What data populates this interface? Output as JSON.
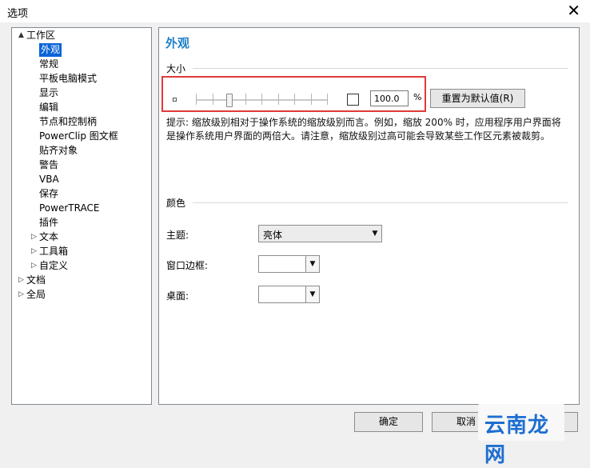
{
  "window": {
    "title": "选项"
  },
  "tree": [
    {
      "label": "工作区",
      "expander": "▲",
      "indent": 0,
      "selected": false
    },
    {
      "label": "外观",
      "expander": "",
      "indent": 1,
      "selected": true
    },
    {
      "label": "常规",
      "expander": "",
      "indent": 1,
      "selected": false
    },
    {
      "label": "平板电脑模式",
      "expander": "",
      "indent": 1,
      "selected": false
    },
    {
      "label": "显示",
      "expander": "",
      "indent": 1,
      "selected": false
    },
    {
      "label": "编辑",
      "expander": "",
      "indent": 1,
      "selected": false
    },
    {
      "label": "节点和控制柄",
      "expander": "",
      "indent": 1,
      "selected": false
    },
    {
      "label": "PowerClip 图文框",
      "expander": "",
      "indent": 1,
      "selected": false
    },
    {
      "label": "贴齐对象",
      "expander": "",
      "indent": 1,
      "selected": false
    },
    {
      "label": "警告",
      "expander": "",
      "indent": 1,
      "selected": false
    },
    {
      "label": "VBA",
      "expander": "",
      "indent": 1,
      "selected": false
    },
    {
      "label": "保存",
      "expander": "",
      "indent": 1,
      "selected": false
    },
    {
      "label": "PowerTRACE",
      "expander": "",
      "indent": 1,
      "selected": false
    },
    {
      "label": "插件",
      "expander": "",
      "indent": 1,
      "selected": false
    },
    {
      "label": "文本",
      "expander": "▷",
      "indent": 1,
      "selected": false
    },
    {
      "label": "工具箱",
      "expander": "▷",
      "indent": 1,
      "selected": false
    },
    {
      "label": "自定义",
      "expander": "▷",
      "indent": 1,
      "selected": false
    },
    {
      "label": "文档",
      "expander": "▷",
      "indent": 0,
      "selected": false
    },
    {
      "label": "全局",
      "expander": "▷",
      "indent": 0,
      "selected": false
    }
  ],
  "panel": {
    "title": "外观",
    "size_section": "大小",
    "zoom_value": "100.0",
    "zoom_unit": "%",
    "zoom_fraction": 0.25,
    "reset_button": "重置为默认值(R)",
    "hint": "提示: 缩放级别相对于操作系统的缩放级别而言。例如，缩放 200% 时，应用程序用户界面将是操作系统用户界面的两倍大。请注意，缩放级别过高可能会导致某些工作区元素被裁剪。",
    "color_section": "颜色",
    "theme_label": "主题:",
    "theme_value": "亮体",
    "border_label": "窗口边框:",
    "border_value": "",
    "desktop_label": "桌面:",
    "desktop_value": ""
  },
  "buttons": {
    "ok": "确定",
    "cancel": "取消",
    "third": ""
  },
  "watermark": {
    "text": "云南龙网"
  },
  "icons": {
    "close": "close-icon",
    "dropdown": "chevron-down-icon"
  },
  "colors": {
    "accent": "#1e7fc8",
    "selection": "#0a64d8",
    "highlight_box": "#e03a3a"
  }
}
